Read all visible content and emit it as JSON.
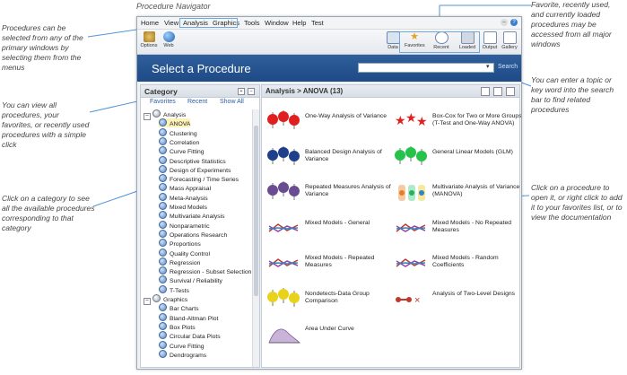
{
  "annotations": {
    "navigator_title": "Procedure Navigator",
    "left_top": "Procedures can be selected from any of the primary windows by selecting them from the menus",
    "left_mid": "You can view all procedures, your favorites, or recently used procedures with a simple click",
    "left_bottom": "Click on a category to see all the available procedures corresponding to that category",
    "right_top": "Favorite, recently used, and currently loaded procedures may be accessed from all major windows",
    "right_mid": "You can enter a topic or key word into the search bar to find related procedures",
    "right_bottom": "Click on a procedure to open it, or right click to add it to your favorites list, or to view the documentation"
  },
  "menu": [
    "Home",
    "View",
    "Analysis",
    "Graphics",
    "Tools",
    "Window",
    "Help",
    "Test"
  ],
  "toolbar": {
    "left": [
      {
        "label": "Options",
        "icon": "options-icon"
      },
      {
        "label": "Web",
        "icon": "globe-icon"
      }
    ],
    "right": [
      {
        "label": "Data",
        "icon": "data-icon"
      },
      {
        "label": "Favorites",
        "icon": "star-icon"
      },
      {
        "label": "Recent",
        "icon": "clock-icon"
      },
      {
        "label": "Loaded",
        "icon": "loaded-icon"
      },
      {
        "label": "Output",
        "icon": "output-icon"
      },
      {
        "label": "Gallery",
        "icon": "gallery-icon"
      }
    ]
  },
  "header": {
    "title": "Select a Procedure",
    "search_value": "",
    "search_button": "Search"
  },
  "category": {
    "title": "Category",
    "tabs": [
      "Favorites",
      "Recent",
      "Show All"
    ],
    "analysis": "Analysis",
    "analysis_items": [
      "ANOVA",
      "Clustering",
      "Correlation",
      "Curve Fitting",
      "Descriptive Statistics",
      "Design of Experiments",
      "Forecasting / Time Series",
      "Mass Appraisal",
      "Meta-Analysis",
      "Mixed Models",
      "Multivariate Analysis",
      "Nonparametric",
      "Operations Research",
      "Proportions",
      "Quality Control",
      "Regression",
      "Regression - Subset Selection",
      "Survival / Reliability",
      "T-Tests"
    ],
    "graphics": "Graphics",
    "graphics_items": [
      "Bar Charts",
      "Bland-Altman Plot",
      "Box Plots",
      "Circular Data Plots",
      "Curve Fitting",
      "Dendrograms"
    ]
  },
  "breadcrumb": "Analysis > ANOVA (13)",
  "procedures": [
    {
      "label": "One-Way Analysis of Variance",
      "icon": "red-balls-icon"
    },
    {
      "label": "Box-Cox for Two or More Groups (T-Test and One-Way ANOVA)",
      "icon": "red-stars-icon"
    },
    {
      "label": "Balanced Design Analysis of Variance",
      "icon": "blue-balls-icon"
    },
    {
      "label": "General Linear Models (GLM)",
      "icon": "green-balls-icon"
    },
    {
      "label": "Repeated Measures Analysis of Variance",
      "icon": "purple-balls-icon"
    },
    {
      "label": "Multivariate Analysis of Variance (MANOVA)",
      "icon": "multi-color-icon"
    },
    {
      "label": "Mixed Models - General",
      "icon": "lines-icon"
    },
    {
      "label": "Mixed Models - No Repeated Measures",
      "icon": "lines-icon"
    },
    {
      "label": "Mixed Models - Repeated Measures",
      "icon": "lines-icon"
    },
    {
      "label": "Mixed Models - Random Coefficients",
      "icon": "lines-icon"
    },
    {
      "label": "Nondetects-Data Group Comparison",
      "icon": "yellow-balls-icon"
    },
    {
      "label": "Analysis of Two-Level Designs",
      "icon": "two-level-icon"
    },
    {
      "label": "Area Under Curve",
      "icon": "area-curve-icon"
    }
  ]
}
